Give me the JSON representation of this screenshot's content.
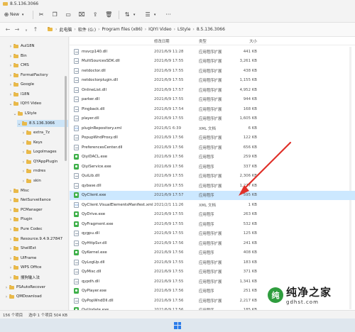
{
  "window": {
    "title": "8.5.136.3066"
  },
  "toolbar": {
    "new_label": "New",
    "sort_icon": "sort-icon",
    "view_icon": "view-icon"
  },
  "address": {
    "breadcrumbs": [
      "此电脑",
      "软件 (G:)",
      "Program files (x86)",
      "IQIYI Video",
      "LStyle",
      "8.5.136.3066"
    ]
  },
  "columns": {
    "date": "修改日期",
    "type": "类型",
    "size": "大小"
  },
  "sidebar": {
    "items": [
      {
        "label": "AuI18N"
      },
      {
        "label": "Bin"
      },
      {
        "label": "CMS"
      },
      {
        "label": "FormatFactory"
      },
      {
        "label": "Google"
      },
      {
        "label": "I18N"
      },
      {
        "label": "IQIYI Video"
      },
      {
        "label": "LStyle"
      },
      {
        "label": "8.5.136.3066"
      },
      {
        "label": "extra_7z"
      },
      {
        "label": "Keys"
      },
      {
        "label": "LogoImages"
      },
      {
        "label": "QYAppPlugin"
      },
      {
        "label": "rndres"
      },
      {
        "label": "skin"
      },
      {
        "label": "Misc"
      },
      {
        "label": "NetSurveillance"
      },
      {
        "label": "PCManager"
      },
      {
        "label": "Plugin"
      },
      {
        "label": "Pure Codec"
      },
      {
        "label": "Resource.9.4.9.27847"
      },
      {
        "label": "ShellExt"
      },
      {
        "label": "UIFrame"
      },
      {
        "label": "WPS Office"
      },
      {
        "label": "搜狗输入法"
      },
      {
        "label": "PSAutoRecover"
      },
      {
        "label": "QMDownload"
      }
    ]
  },
  "files": [
    {
      "name": "msvcp140.dll",
      "date": "2021/6/9 11:28",
      "type": "应用程序扩展",
      "size": "441 KB",
      "kind": "dll"
    },
    {
      "name": "MultiSourcesSDK.dll",
      "date": "2021/6/9 17:55",
      "type": "应用程序扩展",
      "size": "3,261 KB",
      "kind": "dll"
    },
    {
      "name": "netdoctor.dll",
      "date": "2021/6/9 17:55",
      "type": "应用程序扩展",
      "size": "438 KB",
      "kind": "dll"
    },
    {
      "name": "netdoctorplugin.dll",
      "date": "2021/6/9 17:55",
      "type": "应用程序扩展",
      "size": "1,155 KB",
      "kind": "dll"
    },
    {
      "name": "OnlineList.dll",
      "date": "2021/6/9 17:57",
      "type": "应用程序扩展",
      "size": "4,952 KB",
      "kind": "dll"
    },
    {
      "name": "parker.dll",
      "date": "2021/6/9 17:55",
      "type": "应用程序扩展",
      "size": "944 KB",
      "kind": "dll"
    },
    {
      "name": "Pingback.dll",
      "date": "2021/6/9 17:54",
      "type": "应用程序扩展",
      "size": "168 KB",
      "kind": "dll"
    },
    {
      "name": "player.dll",
      "date": "2021/6/9 17:55",
      "type": "应用程序扩展",
      "size": "1,605 KB",
      "kind": "dll"
    },
    {
      "name": "pluginRepository.xml",
      "date": "2021/6/1 6:39",
      "type": "XML 文档",
      "size": "6 KB",
      "kind": "xml"
    },
    {
      "name": "PopupWndProxy.dll",
      "date": "2021/6/9 17:56",
      "type": "应用程序扩展",
      "size": "122 KB",
      "kind": "dll"
    },
    {
      "name": "PreferencesCenter.dll",
      "date": "2021/6/9 17:56",
      "type": "应用程序扩展",
      "size": "656 KB",
      "kind": "dll"
    },
    {
      "name": "QiyiDACL.exe",
      "date": "2021/6/9 17:56",
      "type": "应用程序",
      "size": "259 KB",
      "kind": "exe"
    },
    {
      "name": "QiyiService.exe",
      "date": "2021/6/9 17:56",
      "type": "应用程序",
      "size": "337 KB",
      "kind": "exe"
    },
    {
      "name": "QuiLib.dll",
      "date": "2021/6/9 17:55",
      "type": "应用程序扩展",
      "size": "2,306 KB",
      "kind": "dll"
    },
    {
      "name": "qybase.dll",
      "date": "2021/6/9 17:55",
      "type": "应用程序扩展",
      "size": "1,277 KB",
      "kind": "dll"
    },
    {
      "name": "QyClient.exe",
      "date": "2021/6/9 17:57",
      "type": "应用程序",
      "size": "595 KB",
      "kind": "exe",
      "selected": true
    },
    {
      "name": "QyClient.VisualElementsManifest.xml",
      "date": "2021/2/1 11:26",
      "type": "XML 文档",
      "size": "1 KB",
      "kind": "xml"
    },
    {
      "name": "QyDrive.exe",
      "date": "2021/6/9 17:55",
      "type": "应用程序",
      "size": "263 KB",
      "kind": "exe"
    },
    {
      "name": "QyFragment.exe",
      "date": "2021/6/9 17:55",
      "type": "应用程序",
      "size": "532 KB",
      "kind": "exe"
    },
    {
      "name": "qygpu.dll",
      "date": "2021/6/9 17:55",
      "type": "应用程序扩展",
      "size": "125 KB",
      "kind": "dll"
    },
    {
      "name": "QyHttpSvr.dll",
      "date": "2021/6/9 17:56",
      "type": "应用程序扩展",
      "size": "241 KB",
      "kind": "dll"
    },
    {
      "name": "QyKernel.exe",
      "date": "2021/6/9 17:56",
      "type": "应用程序",
      "size": "408 KB",
      "kind": "exe"
    },
    {
      "name": "QyLogUp.dll",
      "date": "2021/6/9 17:55",
      "type": "应用程序扩展",
      "size": "183 KB",
      "kind": "dll"
    },
    {
      "name": "QyMisc.dll",
      "date": "2021/6/9 17:55",
      "type": "应用程序扩展",
      "size": "371 KB",
      "kind": "dll"
    },
    {
      "name": "qypdh.dll",
      "date": "2021/6/9 17:55",
      "type": "应用程序扩展",
      "size": "1,341 KB",
      "kind": "dll"
    },
    {
      "name": "QyPlayer.exe",
      "date": "2021/6/9 17:56",
      "type": "应用程序",
      "size": "251 KB",
      "kind": "exe"
    },
    {
      "name": "QyPopWndDll.dll",
      "date": "2021/6/9 17:56",
      "type": "应用程序扩展",
      "size": "2,217 KB",
      "kind": "dll"
    },
    {
      "name": "QyUpdate.exe",
      "date": "2021/6/9 17:56",
      "type": "应用程序",
      "size": "185 KB",
      "kind": "exe"
    }
  ],
  "status": {
    "count": "156 个项目",
    "selected": "选中 1 个项目 504 KB"
  },
  "watermark": {
    "title": "纯净之家",
    "url": "gdhst.com",
    "logo_text": "纯"
  },
  "colors": {
    "selected_row": "#cce8ff",
    "folder": "#e9b949",
    "annotation_arrow": "#e0312a"
  }
}
